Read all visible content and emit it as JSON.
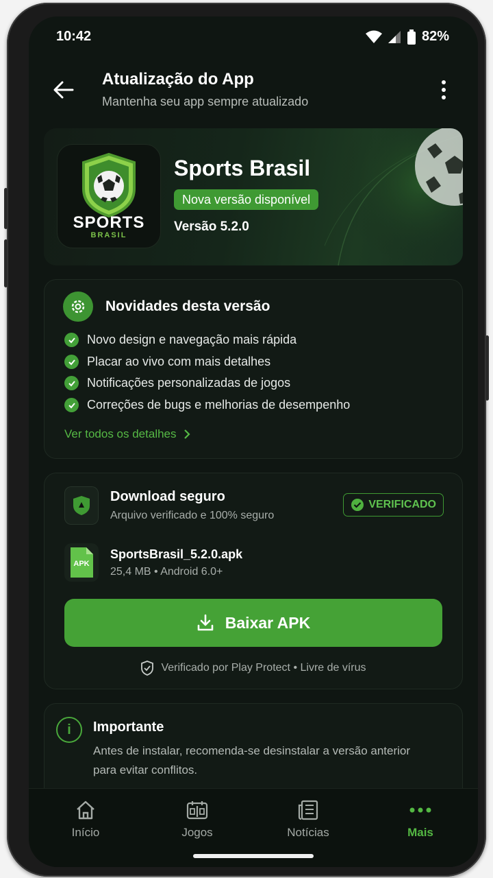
{
  "status_bar": {
    "time": "10:42",
    "battery": "82%"
  },
  "header": {
    "title": "Atualização do App",
    "subtitle": "Mantenha seu app sempre atualizado"
  },
  "hero": {
    "app_name": "Sports Brasil",
    "badge": "Nova versão disponível",
    "version": "Versão 5.2.0",
    "icon_text_main": "SPORTS",
    "icon_text_sub": "BRASIL"
  },
  "whats_new": {
    "title": "Novidades desta versão",
    "items": [
      "Novo design e navegação mais rápida",
      "Placar ao vivo com mais detalhes",
      "Notificações personalizadas de jogos",
      "Correções de bugs e melhorias de desempenho"
    ],
    "link": "Ver todos os detalhes"
  },
  "download": {
    "title": "Download seguro",
    "subtitle": "Arquivo verificado e 100% seguro",
    "verified_badge": "VERIFICADO",
    "file_icon_label": "APK",
    "file_name": "SportsBrasil_5.2.0.apk",
    "file_meta": "25,4 MB • Android 6.0+",
    "button_label": "Baixar APK",
    "protect_text": "Verificado por Play Protect • Livre de vírus"
  },
  "important": {
    "title": "Importante",
    "text": "Antes de instalar, recomenda-se desinstalar a versão anterior para evitar conflitos."
  },
  "bottom_nav": {
    "items": [
      {
        "label": "Início",
        "icon": "home-icon"
      },
      {
        "label": "Jogos",
        "icon": "scoreboard-icon"
      },
      {
        "label": "Notícias",
        "icon": "news-icon"
      },
      {
        "label": "Mais",
        "icon": "more-dots-icon"
      }
    ],
    "active": "Mais"
  },
  "colors": {
    "accent": "#45a236",
    "background": "#0f1612",
    "card": "#121a15"
  }
}
